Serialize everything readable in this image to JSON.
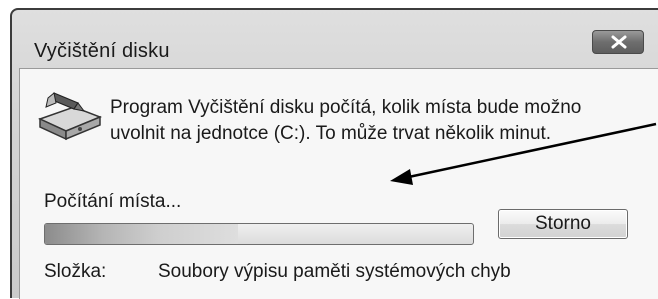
{
  "window": {
    "title": "Vyčištění disku",
    "close_icon": "close-icon"
  },
  "content": {
    "icon": "disk-cleanup-icon",
    "message": "Program Vyčištění disku počítá, kolik místa bude možno uvolnit na jednotce  (C:). To může trvat několik minut.",
    "status": "Počítání místa...",
    "progress_fraction": 0.45,
    "stop_button_label": "Storno",
    "folder_label": "Složka:",
    "folder_value": "Soubory výpisu paměti systémových chyb"
  },
  "colors": {
    "titlebar_bg": "#d3d3d3",
    "content_bg": "#f7f7f7",
    "close_button": "#6e6e6e"
  }
}
